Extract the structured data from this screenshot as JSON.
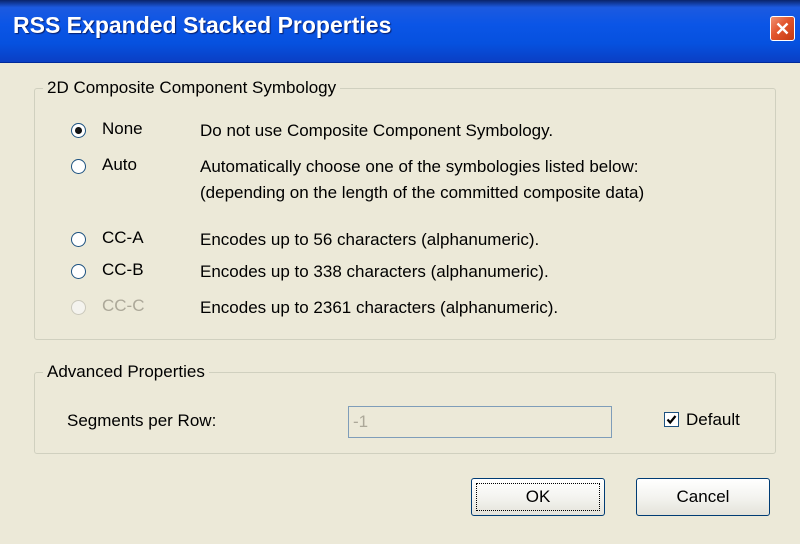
{
  "window": {
    "title": "RSS Expanded Stacked Properties"
  },
  "composite_group": {
    "legend": "2D Composite Component Symbology",
    "options": [
      {
        "label": "None",
        "description": "Do not use Composite Component Symbology.",
        "checked": true,
        "enabled": true
      },
      {
        "label": "Auto",
        "description": "Automatically choose one of the symbologies listed below:",
        "description2": "(depending on the length of the committed composite data)",
        "checked": false,
        "enabled": true
      },
      {
        "label": "CC-A",
        "description": "Encodes up to 56 characters (alphanumeric).",
        "checked": false,
        "enabled": true
      },
      {
        "label": "CC-B",
        "description": "Encodes up to 338 characters (alphanumeric).",
        "checked": false,
        "enabled": true
      },
      {
        "label": "CC-C",
        "description": "Encodes up to 2361 characters (alphanumeric).",
        "checked": false,
        "enabled": false
      }
    ]
  },
  "advanced_group": {
    "legend": "Advanced Properties",
    "segments_label": "Segments per Row:",
    "segments_value": "-1",
    "default_label": "Default",
    "default_checked": true
  },
  "buttons": {
    "ok_label": "OK",
    "cancel_label": "Cancel"
  },
  "colors": {
    "titlebar": "#0b55e6",
    "dialog_bg": "#ece9d8",
    "close_button": "#e2542c",
    "disabled_text": "#aca899"
  },
  "icons": {
    "close": "close-icon",
    "check": "checkmark-icon"
  }
}
